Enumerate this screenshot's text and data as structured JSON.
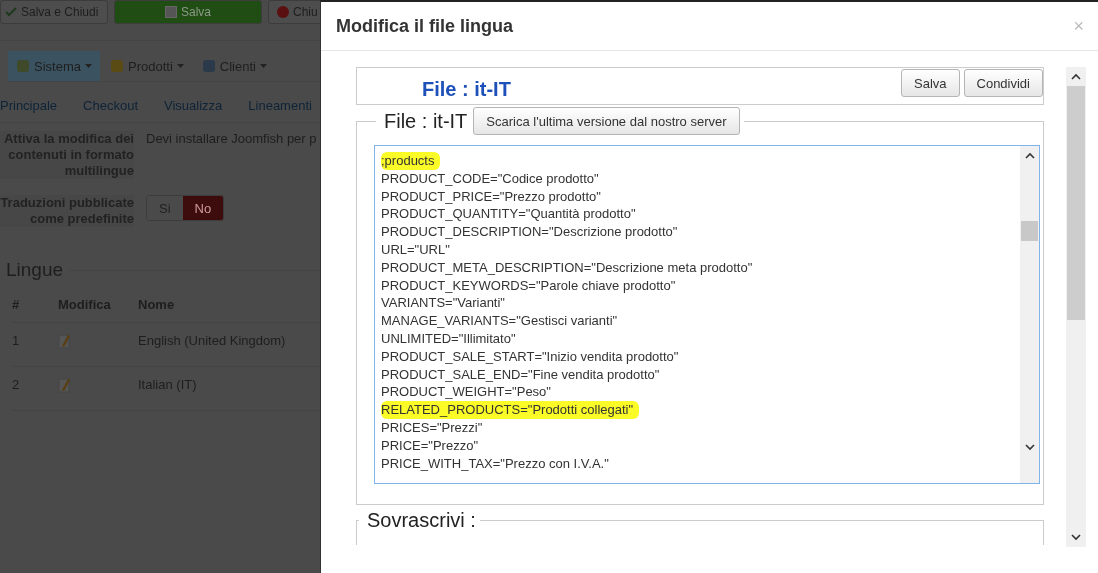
{
  "toolbar": [
    {
      "kind": "check",
      "label": "Salva e Chiudi",
      "primary": false
    },
    {
      "kind": "edit",
      "label": "Salva",
      "primary": true
    },
    {
      "kind": "cancel",
      "label": "Chiu",
      "primary": false
    }
  ],
  "menu": [
    {
      "label": "Sistema",
      "selected": true
    },
    {
      "label": "Prodotti",
      "selected": false
    },
    {
      "label": "Clienti",
      "selected": false
    }
  ],
  "subtabs": [
    "Principale",
    "Checkout",
    "Visualizza",
    "Lineamenti"
  ],
  "settings": [
    {
      "label": "Attiva la modifica dei contenuti in formato multilingue",
      "kind": "text",
      "value": "Devi installare Joomfish per p"
    },
    {
      "label": "Traduzioni pubblicate come predefinite",
      "kind": "toggle",
      "options": [
        {
          "label": "Si",
          "selected": false
        },
        {
          "label": "No",
          "selected": true
        }
      ]
    }
  ],
  "languages": {
    "title": "Lingue",
    "columns": [
      "#",
      "Modifica",
      "Nome"
    ],
    "rows": [
      {
        "num": "1",
        "name": "English (United Kingdom)"
      },
      {
        "num": "2",
        "name": "Italian (IT)"
      }
    ]
  },
  "modal": {
    "title": "Modifica il file lingua",
    "close": "×",
    "file_title": "File : it-IT",
    "buttons": [
      "Salva",
      "Condividi"
    ],
    "legend": "File : it-IT",
    "download_button": "Scarica l'ultima versione dal nostro server",
    "lines": [
      {
        "text": ";products",
        "highlighted": true
      },
      {
        "text": "PRODUCT_CODE=\"Codice prodotto\"",
        "highlighted": false
      },
      {
        "text": "PRODUCT_PRICE=\"Prezzo prodotto\"",
        "highlighted": false
      },
      {
        "text": "PRODUCT_QUANTITY=\"Quantità prodotto\"",
        "highlighted": false
      },
      {
        "text": "PRODUCT_DESCRIPTION=\"Descrizione prodotto\"",
        "highlighted": false
      },
      {
        "text": "URL=\"URL\"",
        "highlighted": false
      },
      {
        "text": "PRODUCT_META_DESCRIPTION=\"Descrizione meta prodotto\"",
        "highlighted": false
      },
      {
        "text": "PRODUCT_KEYWORDS=\"Parole chiave prodotto\"",
        "highlighted": false
      },
      {
        "text": "VARIANTS=\"Varianti\"",
        "highlighted": false
      },
      {
        "text": "MANAGE_VARIANTS=\"Gestisci varianti\"",
        "highlighted": false
      },
      {
        "text": "UNLIMITED=\"Illimitato\"",
        "highlighted": false
      },
      {
        "text": "PRODUCT_SALE_START=\"Inizio vendita prodotto\"",
        "highlighted": false
      },
      {
        "text": "PRODUCT_SALE_END=\"Fine vendita prodotto\"",
        "highlighted": false
      },
      {
        "text": "PRODUCT_WEIGHT=\"Peso\"",
        "highlighted": false
      },
      {
        "text": "RELATED_PRODUCTS=\"Prodotti collegati\"",
        "highlighted": true
      },
      {
        "text": "PRICES=\"Prezzi\"",
        "highlighted": false
      },
      {
        "text": "PRICE=\"Prezzo\"",
        "highlighted": false
      },
      {
        "text": "PRICE_WITH_TAX=\"Prezzo con I.V.A.\"",
        "highlighted": false
      }
    ],
    "override_legend": "Sovrascrivi :"
  }
}
